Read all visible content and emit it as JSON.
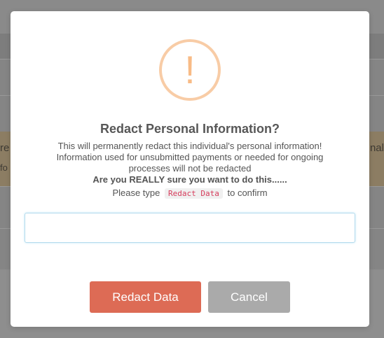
{
  "background": {
    "warning_left_text": "re",
    "warning_left_text2": "fo",
    "warning_right_text": "nal"
  },
  "dialog": {
    "icon": "exclamation-warning-icon",
    "icon_glyph": "!",
    "icon_color": "#f8bb86",
    "title": "Redact Personal Information?",
    "line1": "This will permanently redact this individual's personal information!",
    "line2": "Information used for unsubmitted payments or needed for ongoing processes will not be redacted",
    "line3": "Are you REALLY sure you want to do this......",
    "confirm_prefix": "Please type",
    "confirm_code": "Redact Data",
    "confirm_suffix": "to confirm",
    "input_value": "",
    "confirm_button": "Redact Data",
    "confirm_button_color": "#dd6b55",
    "cancel_button": "Cancel",
    "cancel_button_color": "#aaaaaa"
  }
}
